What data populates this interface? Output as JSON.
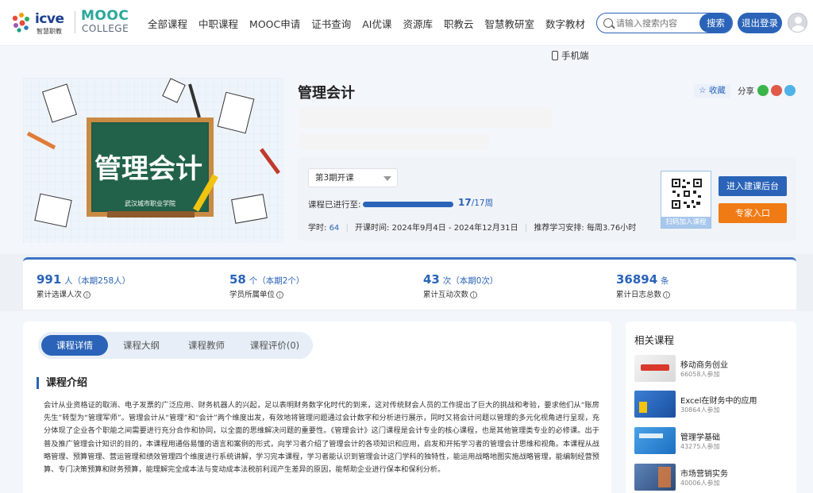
{
  "header": {
    "logo_icve": "icve",
    "logo_icve_sub": "智慧职教",
    "logo_mooc": "MOOC",
    "logo_college": "COLLEGE",
    "nav": [
      "全部课程",
      "中职课程",
      "MOOC申请",
      "证书查询",
      "AI优课",
      "资源库",
      "职教云",
      "智慧教研室",
      "数字教材"
    ],
    "search_placeholder": "请输入搜索内容",
    "search_button": "搜索",
    "logout_button": "退出登录",
    "mobile_link": "手机端"
  },
  "course": {
    "title": "管理会计",
    "image_title": "管理会计",
    "school": "武汉城市职业学院",
    "favorite": "收藏",
    "share": "分享",
    "term": "第3期开课",
    "progress_label": "课程已进行至:",
    "progress_current": "17",
    "progress_total": "/17周",
    "progress_fraction": 1.0,
    "hours_label": "学时:",
    "hours_value": "64",
    "period": "开课时间: 2024年9月4日 - 2024年12月31日",
    "schedule": "推荐学习安排: 每周3.76小时",
    "qr_caption": "扫码加入课程",
    "btn_backend": "进入建课后台",
    "btn_expert": "专家入口"
  },
  "stats": [
    {
      "value": "991",
      "unit": "人（本期258人）",
      "label": "累计选课人次"
    },
    {
      "value": "58",
      "unit": "个（本期2个）",
      "label": "学员所属单位"
    },
    {
      "value": "43",
      "unit": "次（本期0次）",
      "label": "累计互动次数"
    },
    {
      "value": "36894",
      "unit": "条",
      "label": "累计日志总数"
    }
  ],
  "tabs": [
    "课程详情",
    "课程大纲",
    "课程教师",
    "课程评价(0)"
  ],
  "intro": {
    "heading": "课程介绍",
    "text": "会计从业资格证的取消、电子发票的广泛应用、财务机器人的兴起，足以表明财务数字化时代的到来，这对传统财会人员的工作提出了巨大的挑战和考验，要求他们从“账房先生”转型为“管理军师”。管理会计从“管理”和“会计”两个维度出发，有效地将管理问题通过会计数字和分析进行展示，同时又将会计问题以管理的多元化视角进行呈现，充分体现了企业各个职能之间需要进行充分合作和协同，以全面的思维解决问题的重要性。《管理会计》这门课程是会计专业的核心课程，也是其他管理类专业的必修课。出于普及推广管理会计知识的目的，本课程用通俗易懂的语言和案例的形式，向学习者介绍了管理会计的各项知识和应用，启发和开拓学习者的管理会计思维和视角。本课程从战略管理、预算管理、营运管理和绩效管理四个维度进行系统讲解，学习完本课程，学习者能认识到管理会计这门学科的独特性，能运用战略地图实施战略管理，能编制经营预算、专门决策预算和财务预算，能理解完全成本法与变动成本法税前利润产生差异的原因，能帮助企业进行保本和保利分析。"
  },
  "related": {
    "title": "相关课程",
    "items": [
      {
        "name": "移动商务创业",
        "count": "66058人参加"
      },
      {
        "name": "Excel在财务中的应用",
        "count": "30864人参加"
      },
      {
        "name": "管理学基础",
        "count": "43275人参加"
      },
      {
        "name": "市场营销实务",
        "count": "40006人参加"
      }
    ]
  },
  "colors": {
    "primary": "#2a63b8",
    "accent": "#f07a14"
  }
}
